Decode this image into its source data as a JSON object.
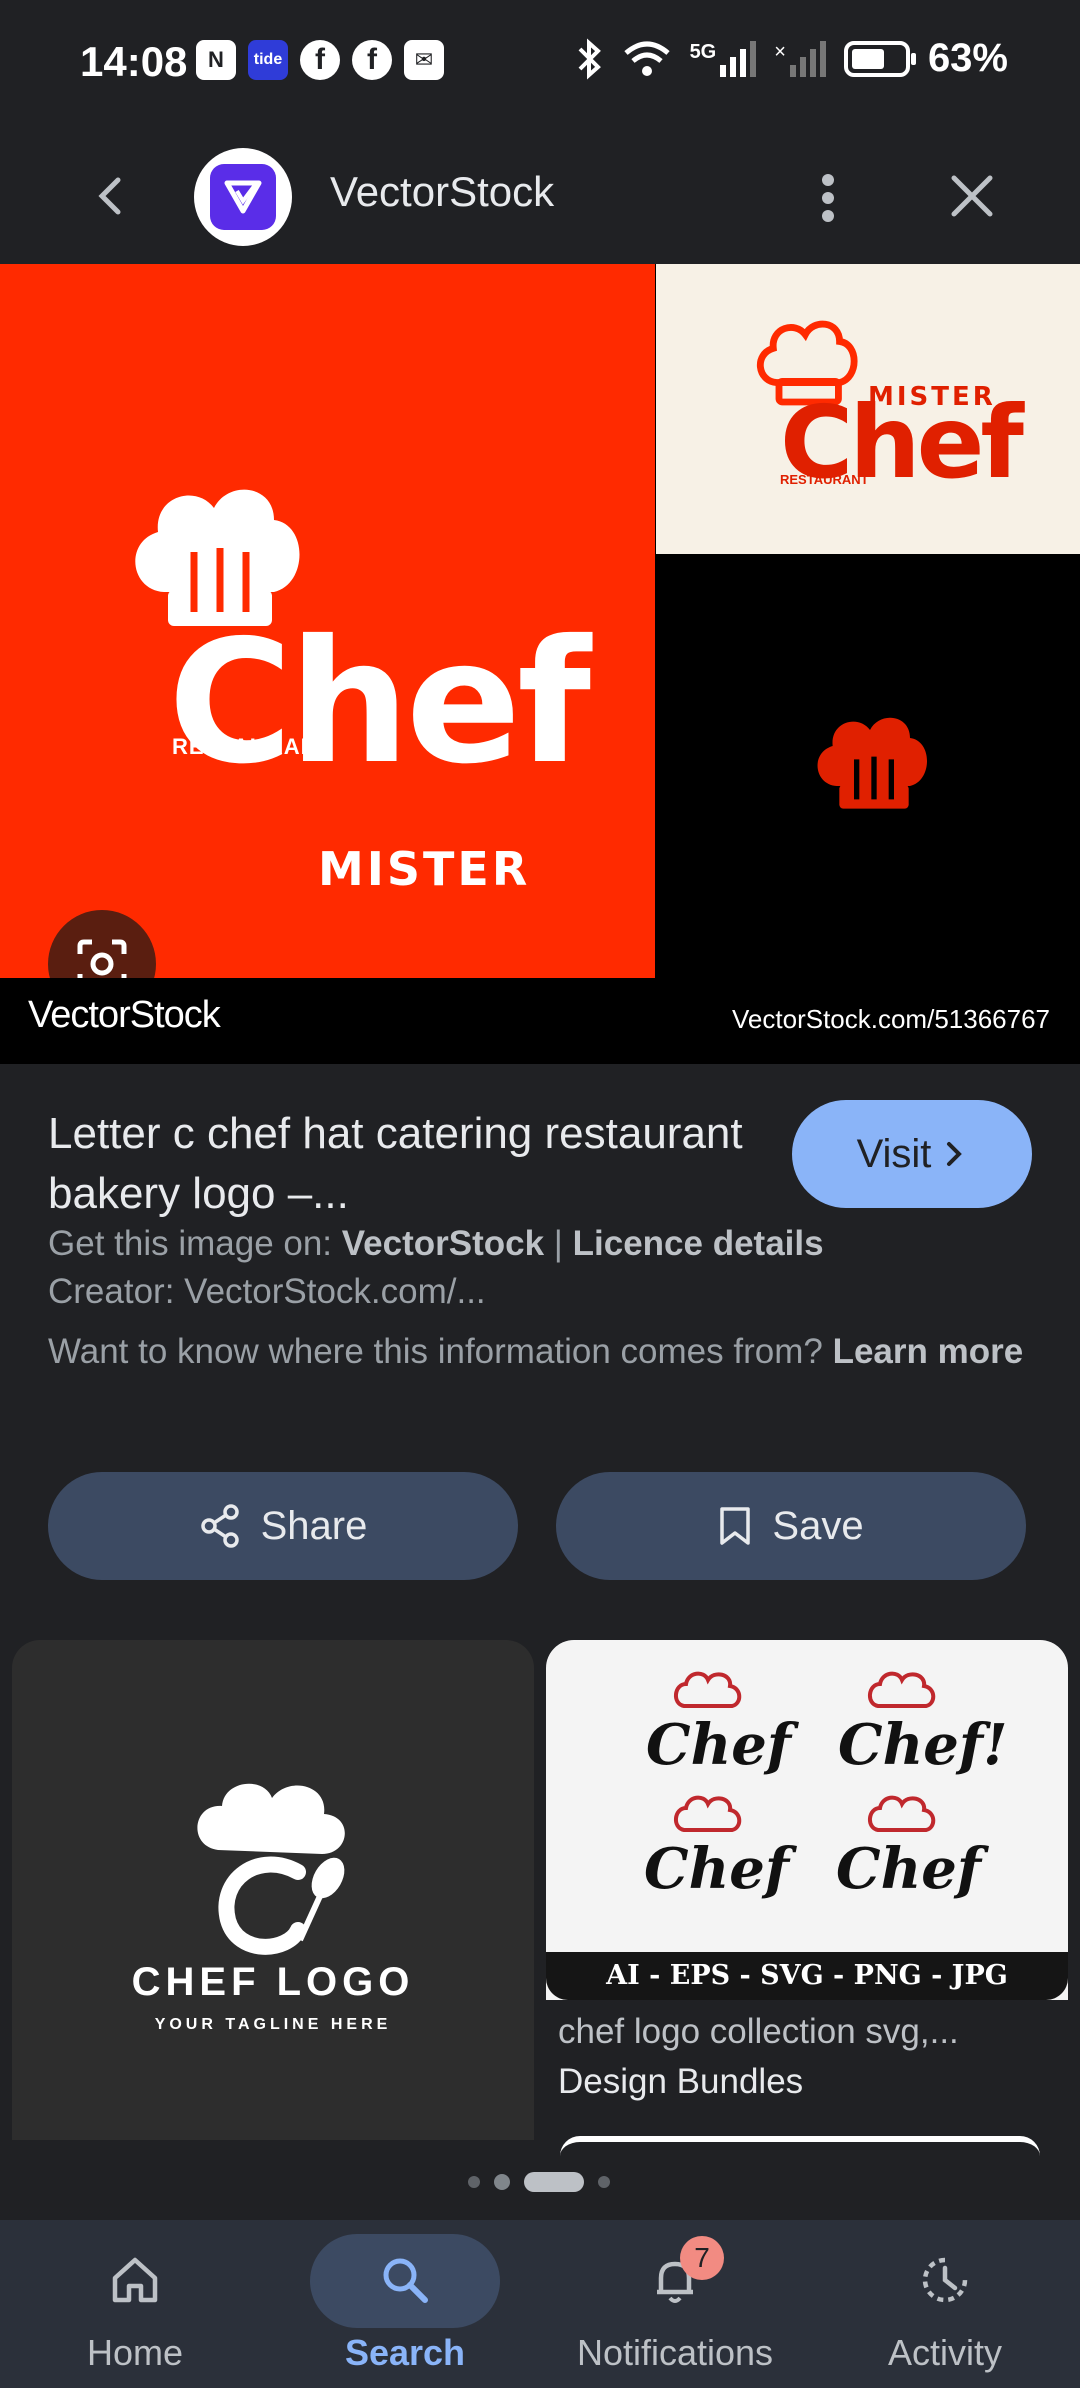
{
  "status_bar": {
    "time": "14:08",
    "notif_icons": [
      "nfc-icon",
      "tide-icon",
      "facebook-icon",
      "facebook-icon",
      "mail-icon"
    ],
    "tide_label": "tide",
    "network": "5G",
    "battery_percent": "63%",
    "battery_level": 0.63
  },
  "header": {
    "site_name": "VectorStock"
  },
  "hero": {
    "main_logo": {
      "mister": "MISTER",
      "chef": "Chef",
      "restaurant": "RESTAURANT"
    },
    "watermark_left": "VectorStock",
    "watermark_right": "VectorStock.com/51366767"
  },
  "result": {
    "title": "Letter c chef hat catering restaurant bakery logo –...",
    "visit_label": "Visit",
    "get_image_prefix": "Get this image on: ",
    "get_image_site": "VectorStock",
    "separator": " | ",
    "licence_link": "Licence details",
    "creator": "Creator: VectorStock.com/...",
    "info_question": "Want to know where this information comes from? ",
    "learn_more": "Learn more"
  },
  "actions": {
    "share_label": "Share",
    "save_label": "Save"
  },
  "related": {
    "card1": {
      "logo_text": "CHEF LOGO",
      "tagline": "YOUR TAGLINE HERE"
    },
    "card2": {
      "mini_logos": [
        "Chef",
        "Chef!",
        "Chef",
        "Chef"
      ],
      "formats": "AI - EPS - SVG - PNG - JPG",
      "title": "chef logo collection svg,...",
      "source": "Design Bundles"
    }
  },
  "nav": {
    "items": [
      {
        "label": "Home",
        "icon": "home-icon"
      },
      {
        "label": "Search",
        "icon": "search-icon"
      },
      {
        "label": "Notifications",
        "icon": "bell-icon"
      },
      {
        "label": "Activity",
        "icon": "activity-icon"
      }
    ],
    "active": "Search",
    "notification_count": "7"
  },
  "colors": {
    "background": "#202124",
    "accent_blue": "#8ab4f8",
    "button_bg": "#3c4a62",
    "brand_red": "#ff2a00",
    "badge": "#f28b82"
  }
}
